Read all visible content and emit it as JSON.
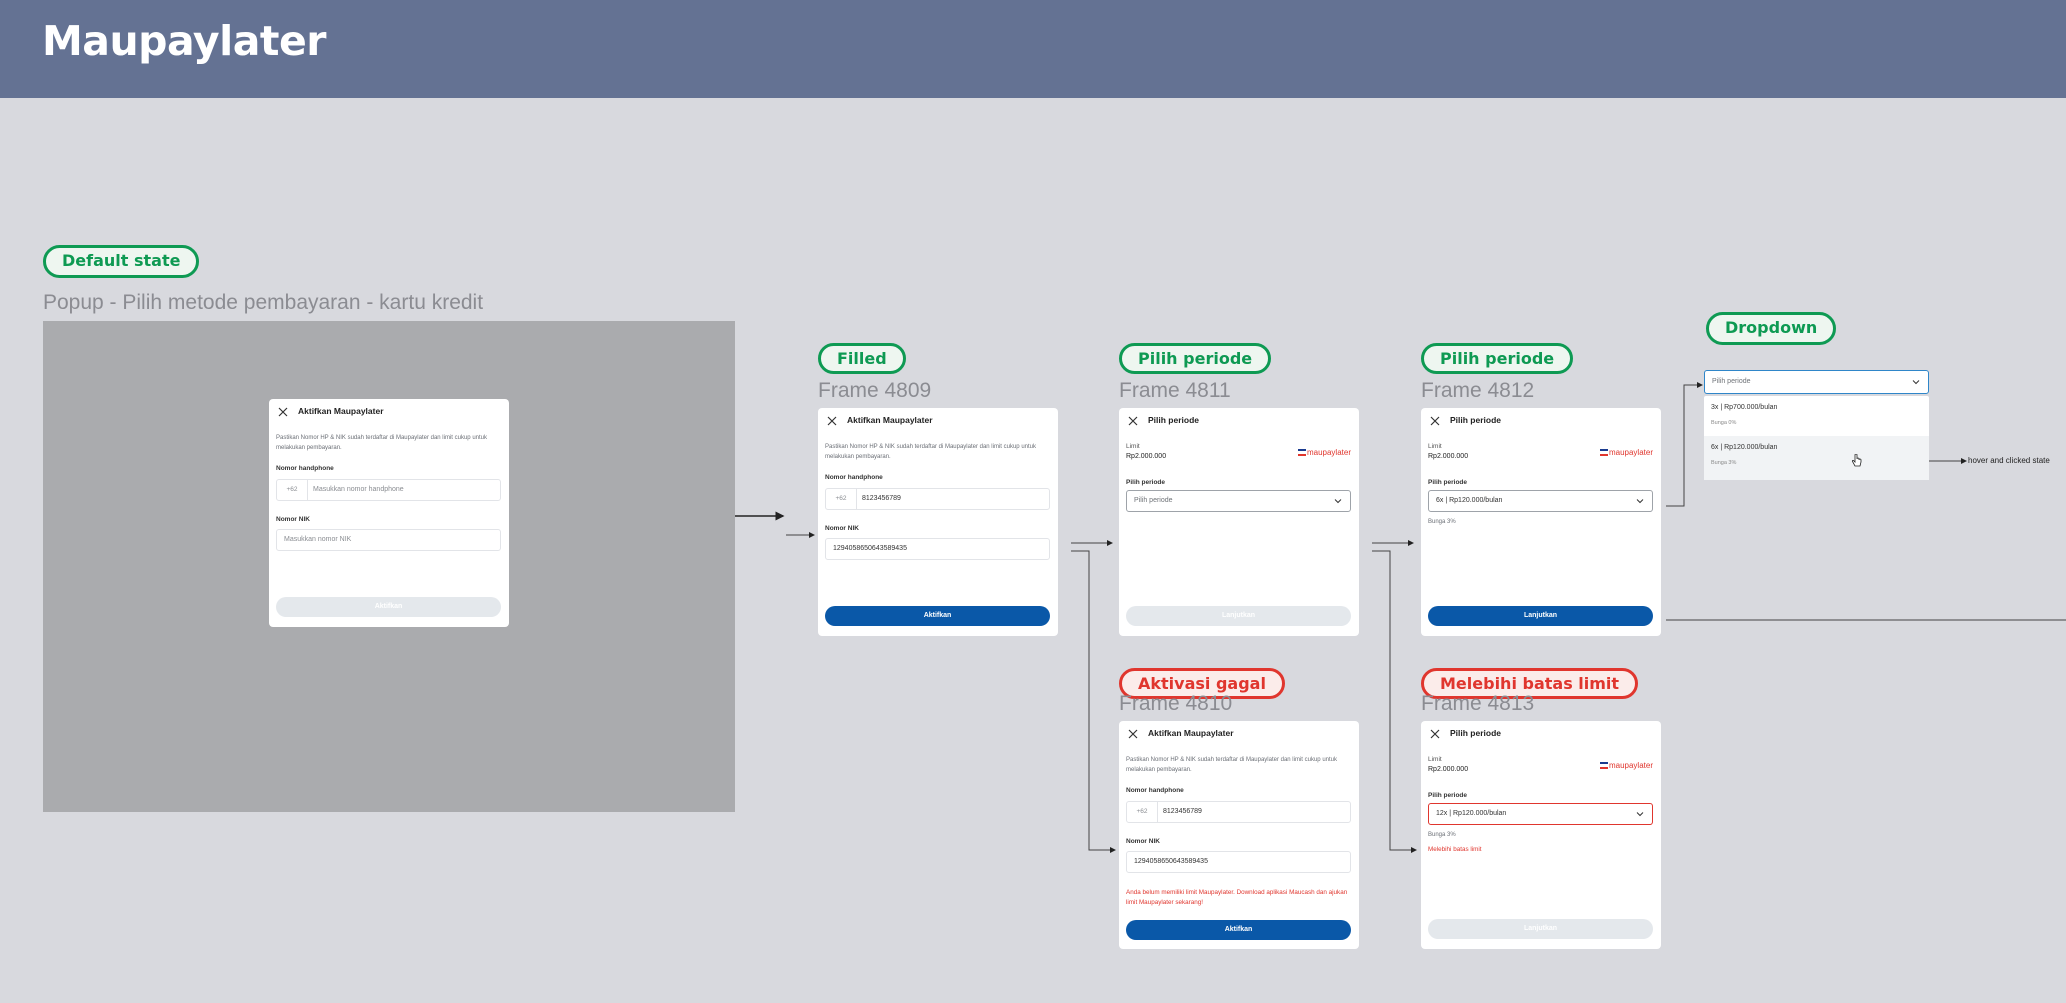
{
  "page": {
    "title": "Maupaylater"
  },
  "labels": {
    "default_state": "Default state",
    "filled": "Filled",
    "pilih_periode_1": "Pilih periode",
    "pilih_periode_2": "Pilih periode",
    "dropdown": "Dropdown",
    "aktivasi_gagal": "Aktivasi gagal",
    "melebihi_batas": "Melebihi batas limit"
  },
  "frame_titles": {
    "popup": "Popup - Pilih metode pembayaran - kartu kredit",
    "f4809": "Frame 4809",
    "f4811": "Frame 4811",
    "f4812": "Frame 4812",
    "f4810": "Frame 4810",
    "f4813": "Frame 4813"
  },
  "activation": {
    "title": "Aktifkan Maupaylater",
    "description": "Pastikan Nomor HP & NIK sudah terdaftar di Maupaylater dan limit cukup untuk melakukan pembayaran.",
    "phone_label": "Nomor handphone",
    "phone_prefix": "+62",
    "phone_placeholder": "Masukkan nomor handphone",
    "phone_value": "8123456789",
    "nik_label": "Nomor NIK",
    "nik_placeholder": "Masukkan nomor NIK",
    "nik_value": "1294058650643589435",
    "button": "Aktifkan",
    "error": "Anda belum memiliki limit Maupaylater. Download aplikasi Maucash dan ajukan limit Maupaylater sekarang!"
  },
  "period": {
    "title": "Pilih periode",
    "limit_label": "Limit",
    "limit_value": "Rp2.000.000",
    "logo": "maupaylater",
    "field_label": "Pilih periode",
    "placeholder": "Pilih periode",
    "selected_6x": "6x | Rp120.000/bulan",
    "selected_12x": "12x | Rp120.000/bulan",
    "interest_note": "Bunga 3%",
    "error": "Melebihi batas limit",
    "button": "Lanjutkan"
  },
  "dropdown": {
    "placeholder": "Pilih periode",
    "options": [
      {
        "label": "3x | Rp700.000/bulan",
        "sub": "Bunga 0%"
      },
      {
        "label": "6x | Rp120.000/bulan",
        "sub": "Bunga 3%"
      }
    ],
    "annotation": "hover and clicked state"
  },
  "icons": {
    "close": "close-icon",
    "chevron": "chevron-down-icon",
    "cursor": "hand-cursor-icon"
  },
  "colors": {
    "header": "#647293",
    "canvas": "#d8d9de",
    "primary_button": "#0a58a8",
    "success": "#0e9a53",
    "error": "#e0362e"
  }
}
